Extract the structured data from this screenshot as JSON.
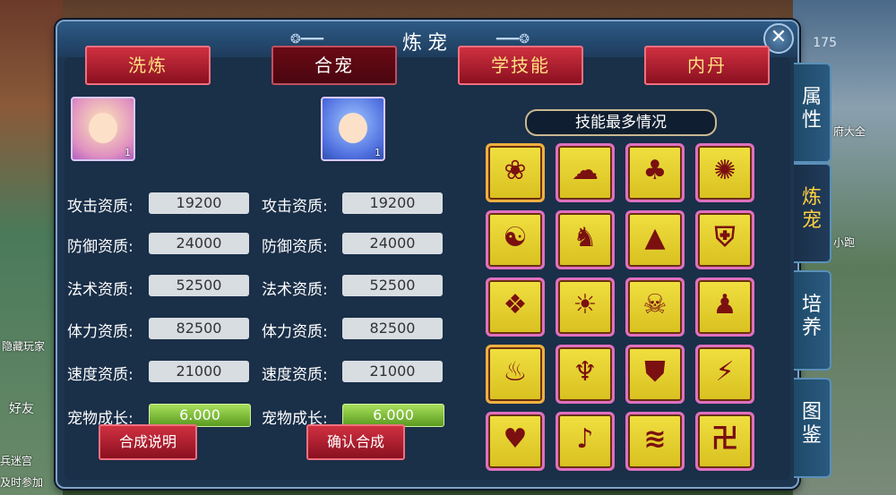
{
  "window": {
    "title": "炼宠",
    "close_label": "✕"
  },
  "hud": {
    "count": "175",
    "left_text_1": "隐藏玩家",
    "left_text_2": "好友",
    "left_text_3": "兵迷宫",
    "left_text_4": "及时参加",
    "right_text_1": "府大全",
    "right_text_2": "小跑"
  },
  "top_tabs": [
    "洗炼",
    "合宠",
    "学技能",
    "内丹"
  ],
  "left_pet": {
    "level": "1",
    "stats": [
      {
        "label": "攻击资质:",
        "value": "19200"
      },
      {
        "label": "防御资质:",
        "value": "24000"
      },
      {
        "label": "法术资质:",
        "value": "52500"
      },
      {
        "label": "体力资质:",
        "value": "82500"
      },
      {
        "label": "速度资质:",
        "value": "21000"
      },
      {
        "label": "宠物成长:",
        "value": "6.000"
      }
    ]
  },
  "right_pet": {
    "level": "1",
    "stats": [
      {
        "label": "攻击资质:",
        "value": "19200"
      },
      {
        "label": "防御资质:",
        "value": "24000"
      },
      {
        "label": "法术资质:",
        "value": "52500"
      },
      {
        "label": "体力资质:",
        "value": "82500"
      },
      {
        "label": "速度资质:",
        "value": "21000"
      },
      {
        "label": "宠物成长:",
        "value": "6.000"
      }
    ]
  },
  "buttons": {
    "merge_info": "合成说明",
    "confirm_merge": "确认合成"
  },
  "skills": {
    "header": "技能最多情况",
    "icons": [
      "swirl-skill-icon",
      "cloud-skill-icon",
      "tree-skill-icon",
      "claw-skill-icon",
      "mind-skill-icon",
      "beast-skill-icon",
      "shadow-skill-icon",
      "shield-skill-icon",
      "turtle-skill-icon",
      "sun-skill-icon",
      "skull-skill-icon",
      "figure-skill-icon",
      "flame-skill-icon",
      "dragon-skill-icon",
      "guard-skill-icon",
      "crack-skill-icon",
      "heart-skill-icon",
      "bird-skill-icon",
      "wind-skill-icon",
      "rune-skill-icon"
    ],
    "gold_frames": [
      0,
      12
    ]
  },
  "side_tabs": [
    "属性",
    "炼宠",
    "培养",
    "图鉴"
  ],
  "colors": {
    "accent_red": "#c02030",
    "panel": "#1e3550",
    "gold_text": "#ffd040"
  }
}
